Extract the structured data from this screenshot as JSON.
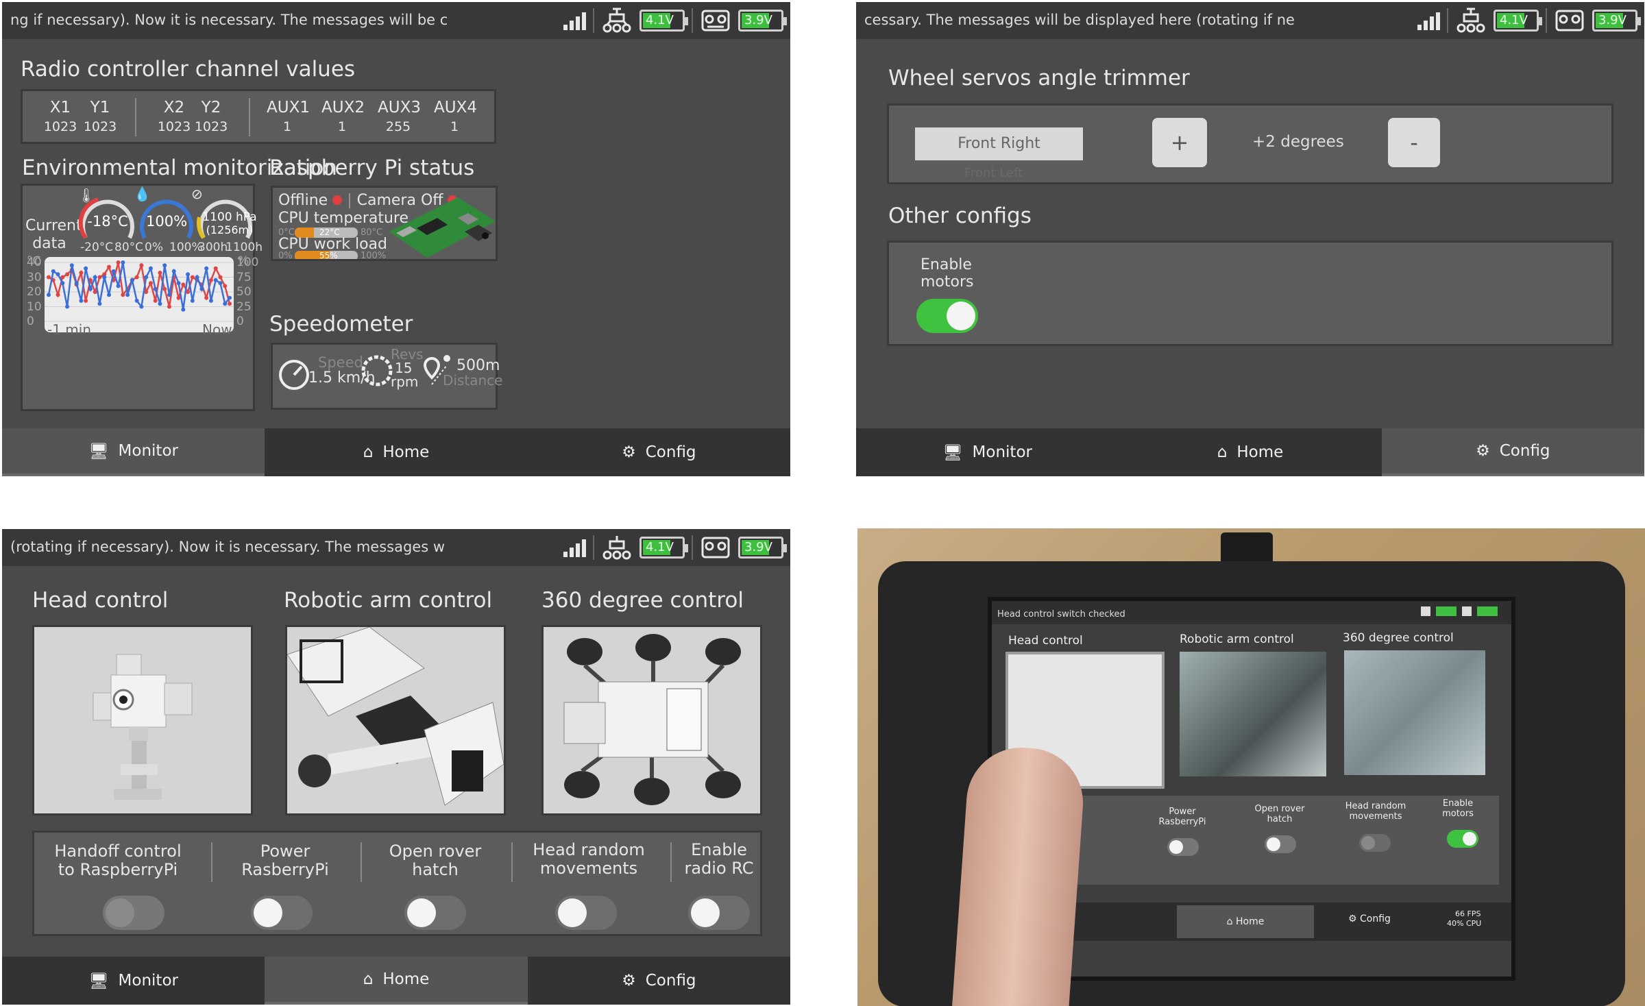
{
  "status_msg_monitor": "ng if necessary). Now it is necessary.     The messages will be c",
  "status_msg_config": "cessary.      The messages will be displayed here (rotating if ne",
  "status_msg_home": "(rotating if necessary). Now it is necessary.     The messages w",
  "battery1": "4.1V",
  "battery2": "3.9V",
  "nav": {
    "monitor": "Monitor",
    "home": "Home",
    "config": "Config"
  },
  "monitor": {
    "radio_title": "Radio controller channel values",
    "channels": [
      {
        "name": "X1",
        "value": "1023"
      },
      {
        "name": "Y1",
        "value": "1023"
      },
      {
        "name": "X2",
        "value": "1023"
      },
      {
        "name": "Y2",
        "value": "1023"
      },
      {
        "name": "AUX1",
        "value": "1"
      },
      {
        "name": "AUX2",
        "value": "1"
      },
      {
        "name": "AUX3",
        "value": "255"
      },
      {
        "name": "AUX4",
        "value": "1"
      }
    ],
    "env_title": "Environmental monitorization",
    "current_data": "Current data",
    "temp_value": "-18°C",
    "temp_min": "-20°C",
    "temp_max": "80°C",
    "hum_value": "100%",
    "hum_min": "0%",
    "hum_max": "100%",
    "press_value": "1100 hPa",
    "press_alt": "(1256m)",
    "press_min": "300h",
    "press_max": "1100h",
    "chart_left_unit": "°C",
    "chart_right_unit": "%",
    "chart_x_start": "-1 min",
    "chart_x_end": "Now",
    "pi_title": "Raspberry Pi status",
    "pi_offline": "Offline",
    "pi_camera": "Camera Off",
    "cpu_temp_label": "CPU temperature",
    "cpu_temp_min": "0°C",
    "cpu_temp_value": "22°C",
    "cpu_temp_max": "80°C",
    "cpu_load_label": "CPU work load",
    "cpu_load_min": "0%",
    "cpu_load_value": "55%",
    "cpu_load_max": "100%",
    "speed_title": "Speedometer",
    "speed_label": "Speed",
    "speed_value": "1.5 km/h",
    "revs_label": "Revs",
    "revs_value": "15",
    "revs_unit": "rpm",
    "dist_value": "500m",
    "dist_label": "Distance"
  },
  "chart_data": {
    "type": "line",
    "x": [
      0,
      1,
      2,
      3,
      4,
      5,
      6,
      7,
      8,
      9,
      10,
      11,
      12,
      13,
      14,
      15,
      16,
      17,
      18,
      19,
      20,
      21,
      22,
      23,
      24,
      25,
      26,
      27,
      28,
      29,
      30,
      31,
      32,
      33,
      34,
      35,
      36,
      37,
      38,
      39
    ],
    "series": [
      {
        "values": [
          30,
          28,
          18,
          30,
          32,
          35,
          25,
          33,
          14,
          28,
          20,
          30,
          32,
          37,
          28,
          40,
          18,
          22,
          28,
          30,
          38,
          20,
          26,
          14,
          33,
          22,
          10,
          30,
          16,
          25,
          20,
          30,
          28,
          25,
          16,
          28,
          36,
          30,
          24,
          12
        ]
      },
      {
        "values": [
          18,
          34,
          32,
          26,
          10,
          38,
          26,
          14,
          36,
          22,
          30,
          12,
          30,
          18,
          34,
          24,
          40,
          18,
          28,
          14,
          10,
          30,
          36,
          22,
          12,
          38,
          18,
          34,
          26,
          8,
          32,
          14,
          30,
          22,
          36,
          14,
          28,
          26,
          12,
          16
        ]
      }
    ],
    "y_left": [
      0,
      10,
      20,
      30,
      40
    ],
    "y_right": [
      0,
      25,
      50,
      75,
      100
    ],
    "ylim": [
      0,
      40
    ]
  },
  "config": {
    "trimmer_title": "Wheel servos angle trimmer",
    "wheel_selected": "Front Right",
    "wheel_next": "Front Left",
    "plus": "+",
    "minus": "-",
    "degrees": "+2 degrees",
    "other_title": "Other configs",
    "enable_motors": "Enable motors"
  },
  "home": {
    "head_title": "Head control",
    "arm_title": "Robotic arm control",
    "deg360_title": "360 degree control",
    "controls": [
      {
        "label": "Handoff control to RaspberryPi"
      },
      {
        "label": "Power RasberryPi"
      },
      {
        "label": "Open rover hatch"
      },
      {
        "label": "Head random movements"
      },
      {
        "label": "Enable radio RC"
      }
    ]
  },
  "photo": {
    "msg": "Head control switch checked",
    "head": "Head control",
    "arm": "Robotic arm control",
    "deg": "360 degree control",
    "c1": "Power RasberryPi",
    "c2": "Open rover hatch",
    "c3": "Head random movements",
    "c4": "Enable motors",
    "home": "Home",
    "config": "Config",
    "fps": "66 FPS",
    "cpu": "40% CPU"
  }
}
